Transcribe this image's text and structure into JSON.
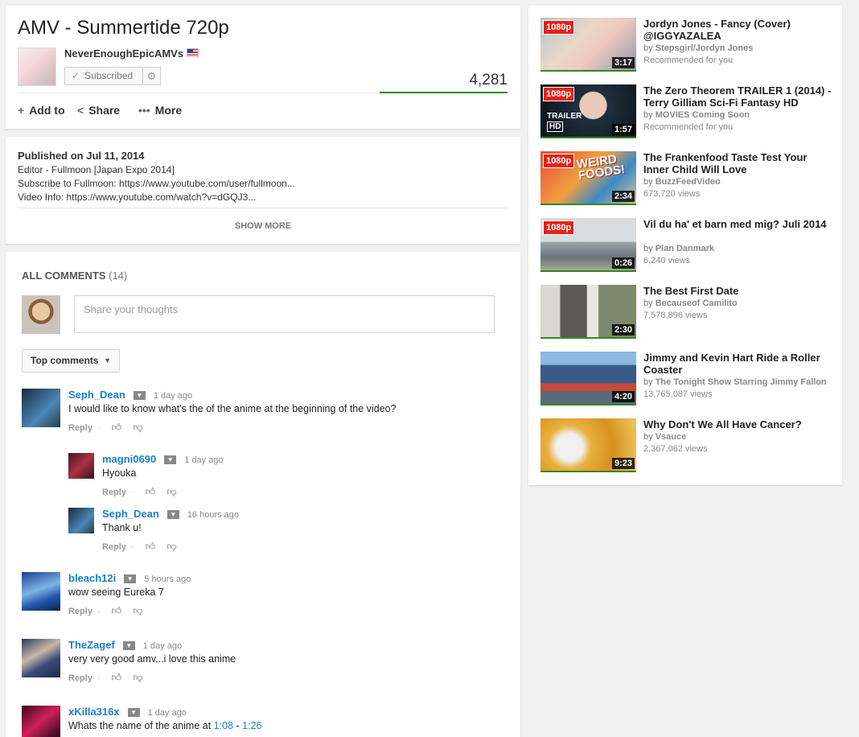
{
  "video": {
    "title": "AMV - Summertide 720p",
    "channel": "NeverEnoughEpicAMVs",
    "subscribe_label": "Subscribed",
    "views": "4,281",
    "actions": {
      "add_to": "Add to",
      "share": "Share",
      "more": "More"
    }
  },
  "description": {
    "published": "Published on Jul 11, 2014",
    "lines": [
      "Editor - Fullmoon [Japan Expo 2014]",
      "Subscribe to Fullmoon: https://www.youtube.com/user/fullmoon...",
      "Video Info: https://www.youtube.com/watch?v=dGQJ3..."
    ],
    "show_more": "SHOW MORE"
  },
  "comments": {
    "heading": "ALL COMMENTS",
    "count": "(14)",
    "placeholder": "Share your thoughts",
    "sort_label": "Top comments",
    "reply_label": "Reply",
    "reply_sep": "·",
    "items": [
      {
        "author": "Seph_Dean",
        "time": "1 day ago",
        "text": "I would like to know what's the of the anime at the beginning of the video?"
      },
      {
        "author": "magni0690",
        "time": "1 day ago",
        "text": "Hyouka"
      },
      {
        "author": "Seph_Dean",
        "time": "16 hours ago",
        "text": "Thank u!"
      },
      {
        "author": "bleach12i",
        "time": "5 hours ago",
        "text": "wow seeing Eureka 7"
      },
      {
        "author": "TheZagef",
        "time": "1 day ago",
        "text": "very very good amv...i love this anime"
      },
      {
        "author": "xKilla316x",
        "time": "1 day ago",
        "text_prefix": "Whats the name of the anime at",
        "link1": "1:08",
        "link_sep": "-",
        "link2": "1:26"
      }
    ]
  },
  "related": [
    {
      "title": "Jordyn Jones - Fancy (Cover) @IGGYAZALEA",
      "by": "Stepsgirl/Jordyn Jones",
      "meta": "Recommended for you",
      "duration": "3:17",
      "hd": "1080p"
    },
    {
      "title": "The Zero Theorem TRAILER 1 (2014) - Terry Gilliam Sci-Fi Fantasy HD",
      "by": "MOVIES Coming Soon",
      "meta": "Recommended for you",
      "duration": "1:57",
      "hd": "1080p",
      "overlay": "TRAILER",
      "overlay_sub": "HD"
    },
    {
      "title": "The Frankenfood Taste Test Your Inner Child Will Love",
      "by": "BuzzFeedVideo",
      "meta": "673,720 views",
      "duration": "2:34",
      "hd": "1080p",
      "overlay": "WEIRD FOODS!"
    },
    {
      "title": "Vil du ha' et barn med mig? Juli 2014",
      "by": "Plan Danmark",
      "meta": "6,240 views",
      "duration": "0:26",
      "hd": "1080p"
    },
    {
      "title": "The Best First Date",
      "by": "Becauseof Camilito",
      "meta": "7,578,896 views",
      "duration": "2:30"
    },
    {
      "title": "Jimmy and Kevin Hart Ride a Roller Coaster",
      "by": "The Tonight Show Starring Jimmy Fallon",
      "meta": "13,765,087 views",
      "duration": "4:20"
    },
    {
      "title": "Why Don't We All Have Cancer?",
      "by": "Vsauce",
      "meta": "2,367,062 views",
      "duration": "9:23"
    }
  ],
  "by_prefix": "by"
}
